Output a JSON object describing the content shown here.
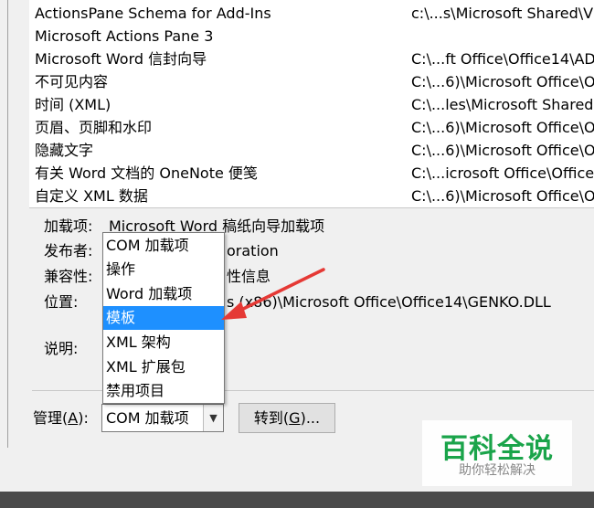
{
  "addins_list": {
    "rows": [
      {
        "name": "ActionsPane Schema for Add-Ins",
        "location": "c:\\...s\\Microsoft Shared\\VS"
      },
      {
        "name": "Microsoft Actions Pane 3",
        "location": ""
      },
      {
        "name": "Microsoft Word 信封向导",
        "location": "C:\\...ft Office\\Office14\\AD"
      },
      {
        "name": "不可见内容",
        "location": "C:\\...6)\\Microsoft Office\\O"
      },
      {
        "name": "时间 (XML)",
        "location": "C:\\...les\\Microsoft Shared"
      },
      {
        "name": "页眉、页脚和水印",
        "location": "C:\\...6)\\Microsoft Office\\O"
      },
      {
        "name": "隐藏文字",
        "location": "C:\\...6)\\Microsoft Office\\O"
      },
      {
        "name": "有关 Word 文档的 OneNote 便笺",
        "location": "C:\\...icrosoft Office\\Office"
      },
      {
        "name": "自定义 XML 数据",
        "location": "C:\\...6)\\Microsoft Office\\O"
      }
    ]
  },
  "details": {
    "addin_label": "加载项:",
    "addin_value": "Microsoft Word 稿纸向导加载项",
    "publisher_label": "发布者:",
    "publisher_value_partial": "oration",
    "compat_label": "兼容性:",
    "compat_value_partial": "性信息",
    "location_label": "位置:",
    "location_value_partial": "s (x86)\\Microsoft Office\\Office14\\GENKO.DLL",
    "desc_label": "说明:"
  },
  "manage": {
    "label": "管理(",
    "accel": "A",
    "label_end": "):",
    "selected": "COM 加载项",
    "options": [
      "COM 加载项",
      "操作",
      "Word 加载项",
      "模板",
      "XML 架构",
      "XML 扩展包",
      "禁用项目"
    ],
    "highlighted": "模板",
    "goto_label": "转到(",
    "goto_accel": "G",
    "goto_end": ")..."
  },
  "watermark": {
    "title": "百科全说",
    "subtitle": "助你轻松解决"
  },
  "colors": {
    "selection": "#1e90ff",
    "annotation_arrow": "#e53935",
    "watermark_green": "#1aa44a"
  }
}
